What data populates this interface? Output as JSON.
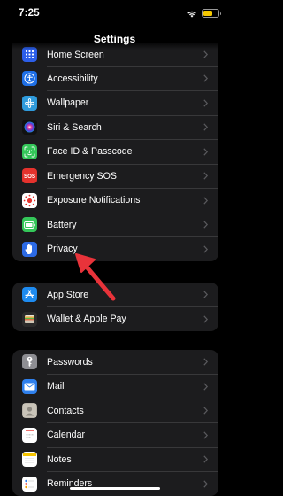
{
  "status_bar": {
    "time": "7:25",
    "battery_color": "#f5c800"
  },
  "nav": {
    "title": "Settings"
  },
  "groups": [
    {
      "items": [
        {
          "label": "Home Screen",
          "icon": "home-screen-icon",
          "color": "#2c5ee8"
        },
        {
          "label": "Accessibility",
          "icon": "accessibility-icon",
          "color": "#1f6fe5"
        },
        {
          "label": "Wallpaper",
          "icon": "wallpaper-icon",
          "color": "#2f9bdc"
        },
        {
          "label": "Siri & Search",
          "icon": "siri-icon",
          "color": "#222"
        },
        {
          "label": "Face ID & Passcode",
          "icon": "face-id-icon",
          "color": "#34c759"
        },
        {
          "label": "Emergency SOS",
          "icon": "sos-icon",
          "color": "#e5322d"
        },
        {
          "label": "Exposure Notifications",
          "icon": "exposure-icon",
          "color": "#ffffff"
        },
        {
          "label": "Battery",
          "icon": "battery-settings-icon",
          "color": "#34c759"
        },
        {
          "label": "Privacy",
          "icon": "privacy-hand-icon",
          "color": "#2c6ae5"
        }
      ]
    },
    {
      "items": [
        {
          "label": "App Store",
          "icon": "app-store-icon",
          "color": "#1e8bf0"
        },
        {
          "label": "Wallet & Apple Pay",
          "icon": "wallet-icon",
          "color": "#2b2b2b"
        }
      ]
    },
    {
      "items": [
        {
          "label": "Passwords",
          "icon": "key-icon",
          "color": "#8e8e93"
        },
        {
          "label": "Mail",
          "icon": "mail-icon",
          "color": "#2f80ed"
        },
        {
          "label": "Contacts",
          "icon": "contacts-icon",
          "color": "#9a9a9a"
        },
        {
          "label": "Calendar",
          "icon": "calendar-icon",
          "color": "#ffffff"
        },
        {
          "label": "Notes",
          "icon": "notes-icon",
          "color": "#ffffff"
        },
        {
          "label": "Reminders",
          "icon": "reminders-icon",
          "color": "#ffffff"
        }
      ]
    }
  ],
  "annotation": {
    "arrow_color": "#e8333a"
  }
}
